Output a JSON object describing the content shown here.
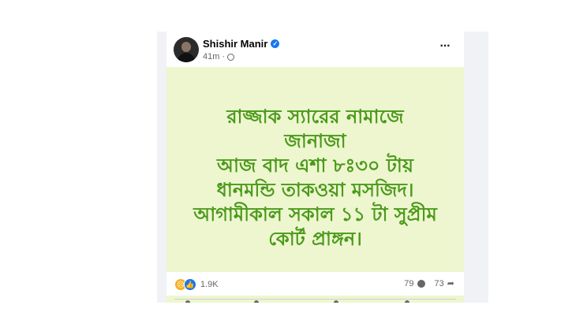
{
  "post": {
    "author": "Shishir Manir",
    "time": "41m",
    "body_text": "রাজ্জাক স্যারের নামাজে\nজানাজা\nআজ বাদ এশা ৮ঃ৩০ টায়\nধানমন্ডি তাকওয়া মসজিদ।\nআগামীকাল সকাল ১১ টা সুপ্রীম\nকোর্ট প্রাঙ্গন।",
    "reaction_count": "1.9K",
    "comment_count": "79",
    "share_count": "73"
  },
  "icons": {
    "verified": "verified-badge-icon",
    "privacy": "globe-icon",
    "more": "more-options-icon",
    "sad": "sad-reaction-icon",
    "like": "like-reaction-icon",
    "comment": "comment-icon",
    "share": "share-icon"
  },
  "colors": {
    "post_background": "#eef6cf",
    "post_text": "#4a9a1a",
    "verified": "#1877f2",
    "secondary_text": "#65676b"
  }
}
